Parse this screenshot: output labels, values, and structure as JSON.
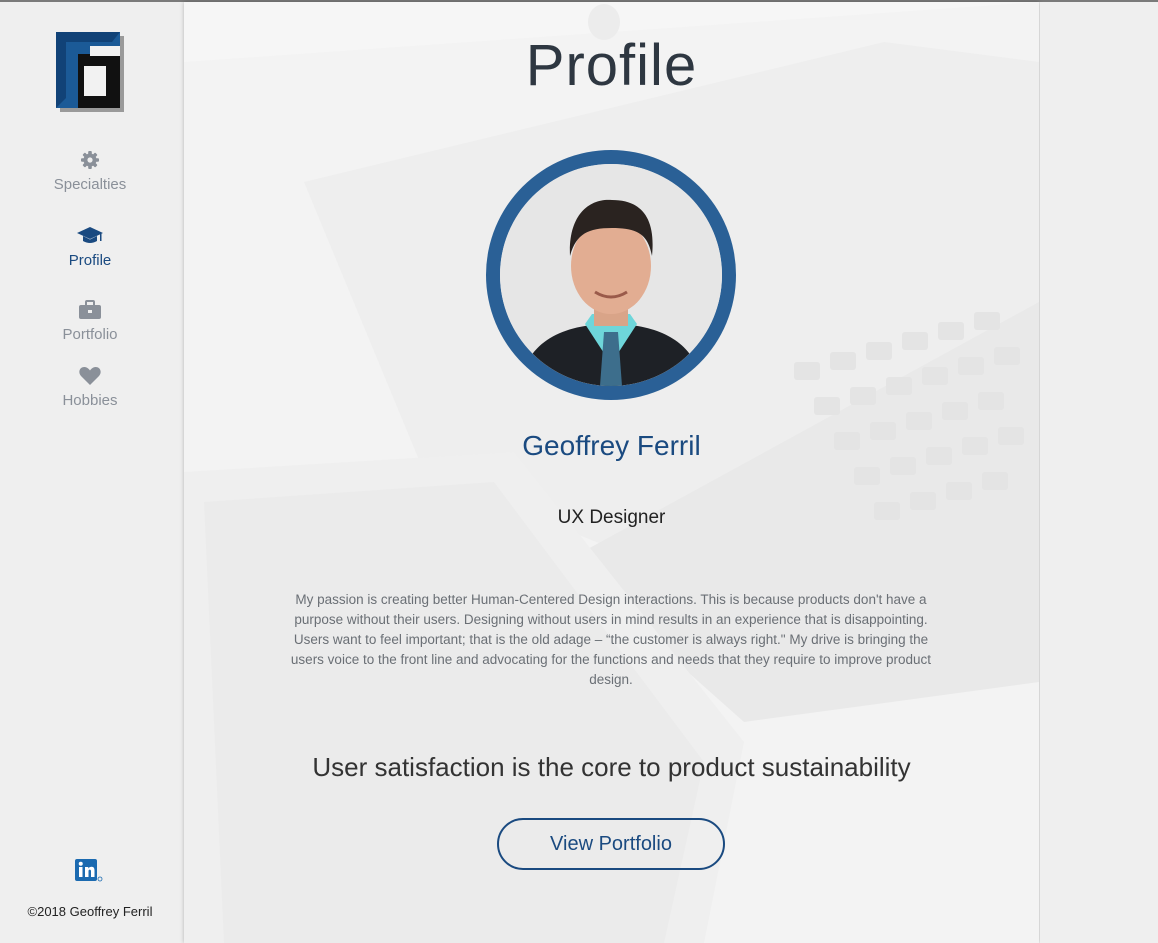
{
  "sidebar": {
    "logo": "logo-mark",
    "items": [
      {
        "label": "Specialties",
        "icon": "gear-icon",
        "active": false
      },
      {
        "label": "Profile",
        "icon": "graduation-cap-icon",
        "active": true
      },
      {
        "label": "Portfolio",
        "icon": "briefcase-icon",
        "active": false
      },
      {
        "label": "Hobbies",
        "icon": "heart-icon",
        "active": false
      }
    ],
    "linkedin_icon": "linkedin-icon",
    "copyright": "©2018 Geoffrey Ferril"
  },
  "main": {
    "title": "Profile",
    "name": "Geoffrey Ferril",
    "role": "UX Designer",
    "bio": "My passion is creating better Human-Centered Design interactions. This is because products don't have a purpose without their users. Designing without users in mind results in an experience that is disappointing. Users want to feel important; that is the old adage – “the customer is always right.\" My drive is bringing the users voice to the front line and advocating for the functions and needs that they require to improve product design.",
    "tagline": "User satisfaction is the core to product sustainability",
    "cta_label": "View Portfolio"
  },
  "colors": {
    "accent": "#1a4a80",
    "avatar_ring": "#2a6096",
    "nav_inactive": "#8a9099"
  }
}
